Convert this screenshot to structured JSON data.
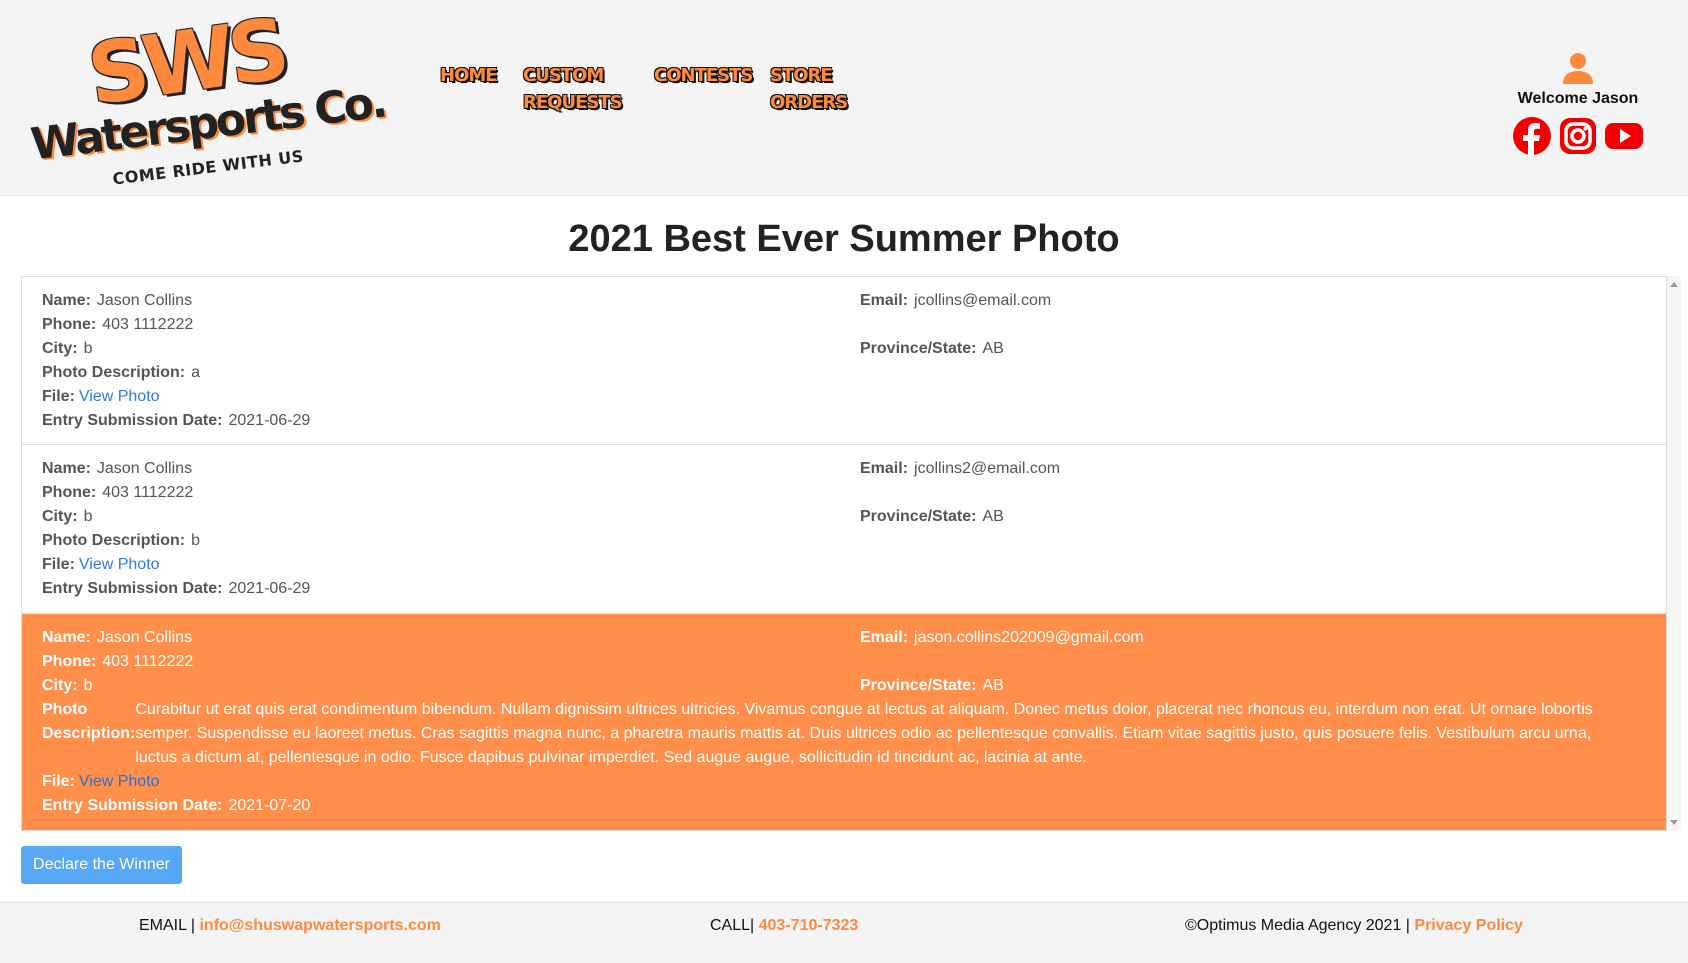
{
  "brand": {
    "logo_main": "SWS",
    "logo_sub": "Watersports Co.",
    "logo_tagline": "COME RIDE WITH US",
    "accent_color": "#ff8a3d"
  },
  "nav": {
    "items": [
      {
        "label": "HOME"
      },
      {
        "label": "CUSTOM\nREQUESTS"
      },
      {
        "label": "CONTESTS"
      },
      {
        "label": "STORE\nORDERS"
      }
    ]
  },
  "user": {
    "icon": "user-icon",
    "welcome": "Welcome Jason"
  },
  "socials": [
    {
      "icon": "facebook-icon",
      "color": "#f00000"
    },
    {
      "icon": "instagram-icon",
      "color": "#f00000"
    },
    {
      "icon": "youtube-icon",
      "color": "#f00000"
    }
  ],
  "page": {
    "title": "2021 Best Ever Summer Photo"
  },
  "labels": {
    "name": "Name:",
    "phone": "Phone:",
    "city": "City:",
    "photo_description": "Photo Description:",
    "file": "File:",
    "entry_date": "Entry Submission Date:",
    "email": "Email:",
    "province": "Province/State:"
  },
  "entries": [
    {
      "name": "Jason Collins",
      "phone": "403 1112222",
      "city": "b",
      "description": "a",
      "file_link": "View Photo",
      "date": "2021-06-29",
      "email": "jcollins@email.com",
      "province": "AB",
      "selected": false
    },
    {
      "name": "Jason Collins",
      "phone": "403 1112222",
      "city": "b",
      "description": "b",
      "file_link": "View Photo",
      "date": "2021-06-29",
      "email": "jcollins2@email.com",
      "province": "AB",
      "selected": false
    },
    {
      "name": "Jason Collins",
      "phone": "403 1112222",
      "city": "b",
      "description": "Curabitur ut erat quis erat condimentum bibendum. Nullam dignissim ultrices ultricies. Vivamus congue at lectus at aliquam. Donec metus dolor, placerat nec rhoncus eu, interdum non erat. Ut ornare lobortis semper. Suspendisse eu laoreet metus. Cras sagittis magna nunc, a pharetra mauris mattis at. Duis ultrices odio ac pellentesque convallis. Etiam vitae sagittis justo, quis posuere felis. Vestibulum arcu urna, luctus a dictum at, pellentesque in odio. Fusce dapibus pulvinar imperdiet. Sed augue augue, sollicitudin id tincidunt ac, lacinia at ante.",
      "file_link": "View Photo",
      "date": "2021-07-20",
      "email": "jason.collins202009@gmail.com",
      "province": "AB",
      "selected": true,
      "selected_color": "#ff8f4b"
    }
  ],
  "actions": {
    "declare_winner": "Declare the Winner",
    "button_color": "#58a8f5"
  },
  "footer": {
    "email_label": "EMAIL |",
    "email_value": "info@shuswapwatersports.com",
    "call_label": "CALL|",
    "call_value": "403-710-7323",
    "copyright": "©Optimus Media Agency 2021 |",
    "privacy": "Privacy Policy"
  }
}
